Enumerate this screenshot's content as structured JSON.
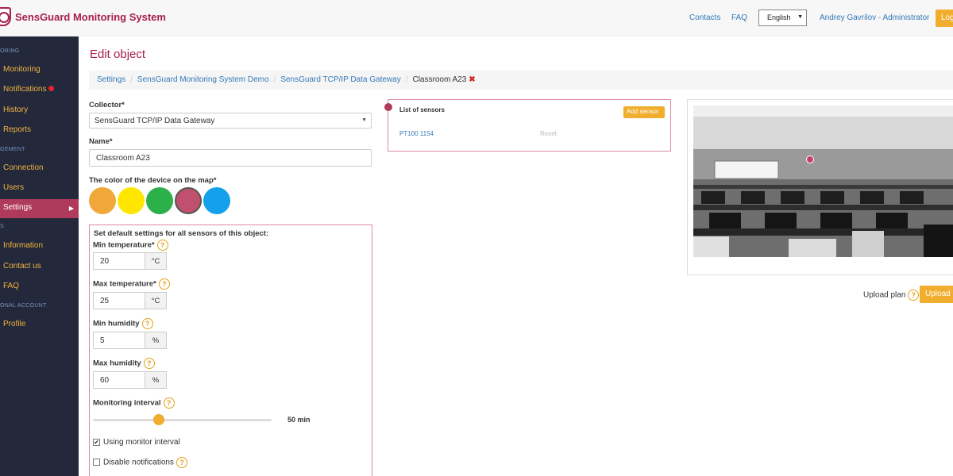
{
  "header": {
    "brand": "SensGuard Monitoring System",
    "contacts": "Contacts",
    "faq": "FAQ",
    "language": "English",
    "user": "Andrey Gavrilov - Administrator",
    "logout": "Log"
  },
  "sidebar": {
    "section_monitoring": "ORING",
    "section_management": "GEMENT",
    "section_info": "S",
    "section_account": "ONAL ACCOUNT",
    "items": [
      {
        "label": "Monitoring"
      },
      {
        "label": "Notifications"
      },
      {
        "label": "History"
      },
      {
        "label": "Reports"
      },
      {
        "label": "Connection"
      },
      {
        "label": "Users"
      },
      {
        "label": "Settings"
      },
      {
        "label": "Information"
      },
      {
        "label": "Contact us"
      },
      {
        "label": "FAQ"
      },
      {
        "label": "Profile"
      }
    ]
  },
  "page": {
    "title": "Edit object",
    "breadcrumb": [
      "Settings",
      "SensGuard Monitoring System Demo",
      "SensGuard TCP/IP Data Gateway",
      "Classroom A23"
    ]
  },
  "form": {
    "collector_label": "Collector*",
    "collector_value": "SensGuard TCP/IP Data Gateway",
    "name_label": "Name*",
    "name_value": "Classroom A23",
    "color_label": "The color of the device on the map*",
    "colors": [
      "#f0a83a",
      "#ffe600",
      "#2bb04a",
      "#c0506e",
      "#14a0ea"
    ],
    "defaults_title": "Set default settings for all sensors of this object:",
    "min_temp_label": "Min temperature*",
    "min_temp_value": "20",
    "max_temp_label": "Max temperature*",
    "max_temp_value": "25",
    "temp_unit": "°C",
    "min_hum_label": "Min humidity",
    "min_hum_value": "5",
    "max_hum_label": "Max humidity",
    "max_hum_value": "60",
    "hum_unit": "%",
    "interval_label": "Monitoring interval",
    "interval_value": "50 min",
    "interval_fraction": 0.37,
    "use_interval_label": "Using monitor interval",
    "use_interval_checked": true,
    "disable_notif_label": "Disable notifications",
    "disable_notif_checked": false,
    "help_glyph": "?"
  },
  "sensors": {
    "title": "List of sensors",
    "add_button": "Add sensor",
    "items": [
      {
        "name": "PT100 1154",
        "action": "Reset"
      }
    ]
  },
  "plan": {
    "upload_label": "Upload plan",
    "upload_button": "Upload p"
  }
}
